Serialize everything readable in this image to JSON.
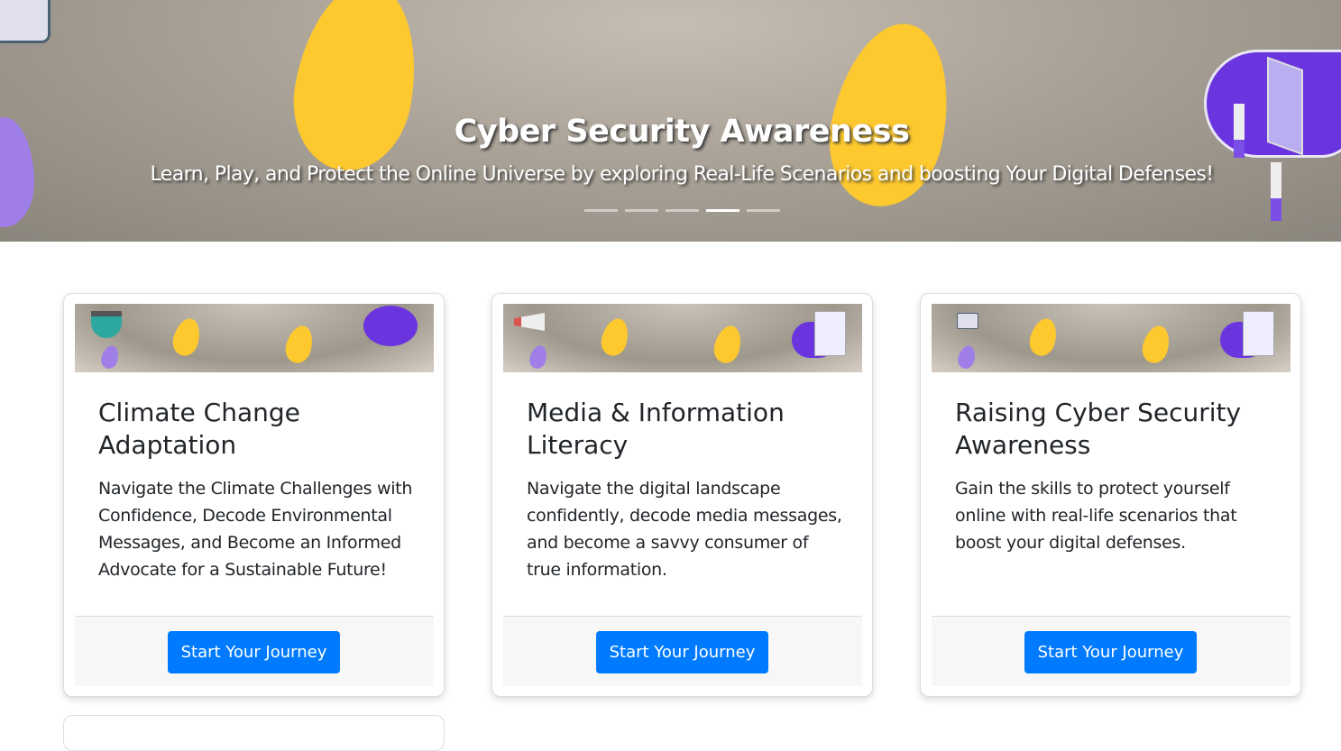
{
  "hero": {
    "title": "Cyber Security Awareness",
    "subtitle": "Learn, Play, and Protect the Online Universe by exploring Real-Life Scenarios and boosting Your Digital Defenses!",
    "slide_count": 5,
    "active_slide": 4
  },
  "cards": [
    {
      "title": "Climate Change Adaptation",
      "text": "Navigate the Climate Challenges with Confidence, Decode Environmental Messages, and Become an Informed Advocate for a Sustainable Future!",
      "button": "Start Your Journey"
    },
    {
      "title": "Media & Information Literacy",
      "text": "Navigate the digital landscape confidently, decode media messages, and become a savvy consumer of true information.",
      "button": "Start Your Journey"
    },
    {
      "title": "Raising Cyber Security Awareness",
      "text": "Gain the skills to protect yourself online with real-life scenarios that boost your digital defenses.",
      "button": "Start Your Journey"
    }
  ]
}
